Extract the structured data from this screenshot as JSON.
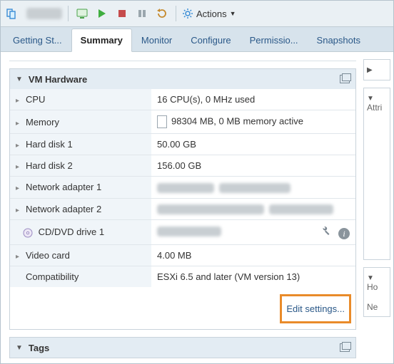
{
  "toolbar": {
    "actions_label": "Actions"
  },
  "tabs": [
    {
      "label": "Getting St..."
    },
    {
      "label": "Summary"
    },
    {
      "label": "Monitor"
    },
    {
      "label": "Configure"
    },
    {
      "label": "Permissio..."
    },
    {
      "label": "Snapshots"
    }
  ],
  "hw_panel": {
    "title": "VM Hardware",
    "edit_label": "Edit settings...",
    "rows": {
      "cpu": {
        "label": "CPU",
        "value": "16 CPU(s), 0 MHz used"
      },
      "memory": {
        "label": "Memory",
        "value": "98304 MB, 0 MB memory active"
      },
      "hdd1": {
        "label": "Hard disk 1",
        "value": "50.00 GB"
      },
      "hdd2": {
        "label": "Hard disk 2",
        "value": "156.00 GB"
      },
      "nic1": {
        "label": "Network adapter 1"
      },
      "nic2": {
        "label": "Network adapter 2"
      },
      "cddvd": {
        "label": "CD/DVD drive 1"
      },
      "video": {
        "label": "Video card",
        "value": "4.00 MB"
      },
      "compat": {
        "label": "Compatibility",
        "value": "ESXi 6.5 and later (VM version 13)"
      }
    }
  },
  "tags_panel": {
    "title": "Tags"
  },
  "side": {
    "attri_label": "Attri",
    "ho_label": "Ho",
    "ne_label": "Ne"
  }
}
